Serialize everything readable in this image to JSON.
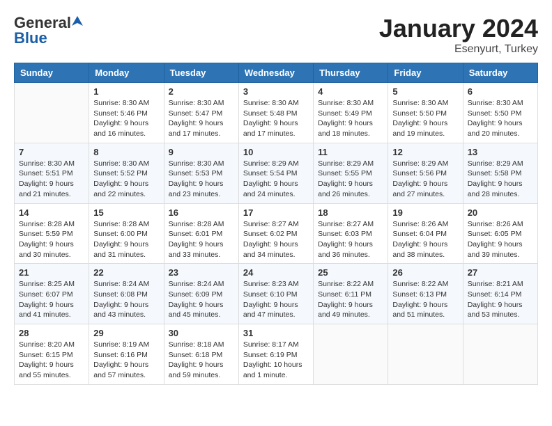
{
  "header": {
    "logo_general": "General",
    "logo_blue": "Blue",
    "month_title": "January 2024",
    "subtitle": "Esenyurt, Turkey"
  },
  "calendar": {
    "days_of_week": [
      "Sunday",
      "Monday",
      "Tuesday",
      "Wednesday",
      "Thursday",
      "Friday",
      "Saturday"
    ],
    "weeks": [
      [
        {
          "day": "",
          "info": ""
        },
        {
          "day": "1",
          "info": "Sunrise: 8:30 AM\nSunset: 5:46 PM\nDaylight: 9 hours\nand 16 minutes."
        },
        {
          "day": "2",
          "info": "Sunrise: 8:30 AM\nSunset: 5:47 PM\nDaylight: 9 hours\nand 17 minutes."
        },
        {
          "day": "3",
          "info": "Sunrise: 8:30 AM\nSunset: 5:48 PM\nDaylight: 9 hours\nand 17 minutes."
        },
        {
          "day": "4",
          "info": "Sunrise: 8:30 AM\nSunset: 5:49 PM\nDaylight: 9 hours\nand 18 minutes."
        },
        {
          "day": "5",
          "info": "Sunrise: 8:30 AM\nSunset: 5:50 PM\nDaylight: 9 hours\nand 19 minutes."
        },
        {
          "day": "6",
          "info": "Sunrise: 8:30 AM\nSunset: 5:50 PM\nDaylight: 9 hours\nand 20 minutes."
        }
      ],
      [
        {
          "day": "7",
          "info": ""
        },
        {
          "day": "8",
          "info": "Sunrise: 8:30 AM\nSunset: 5:52 PM\nDaylight: 9 hours\nand 22 minutes."
        },
        {
          "day": "9",
          "info": "Sunrise: 8:30 AM\nSunset: 5:53 PM\nDaylight: 9 hours\nand 23 minutes."
        },
        {
          "day": "10",
          "info": "Sunrise: 8:29 AM\nSunset: 5:54 PM\nDaylight: 9 hours\nand 24 minutes."
        },
        {
          "day": "11",
          "info": "Sunrise: 8:29 AM\nSunset: 5:55 PM\nDaylight: 9 hours\nand 26 minutes."
        },
        {
          "day": "12",
          "info": "Sunrise: 8:29 AM\nSunset: 5:56 PM\nDaylight: 9 hours\nand 27 minutes."
        },
        {
          "day": "13",
          "info": "Sunrise: 8:29 AM\nSunset: 5:58 PM\nDaylight: 9 hours\nand 28 minutes."
        }
      ],
      [
        {
          "day": "14",
          "info": ""
        },
        {
          "day": "15",
          "info": "Sunrise: 8:28 AM\nSunset: 6:00 PM\nDaylight: 9 hours\nand 31 minutes."
        },
        {
          "day": "16",
          "info": "Sunrise: 8:28 AM\nSunset: 6:01 PM\nDaylight: 9 hours\nand 33 minutes."
        },
        {
          "day": "17",
          "info": "Sunrise: 8:27 AM\nSunset: 6:02 PM\nDaylight: 9 hours\nand 34 minutes."
        },
        {
          "day": "18",
          "info": "Sunrise: 8:27 AM\nSunset: 6:03 PM\nDaylight: 9 hours\nand 36 minutes."
        },
        {
          "day": "19",
          "info": "Sunrise: 8:26 AM\nSunset: 6:04 PM\nDaylight: 9 hours\nand 38 minutes."
        },
        {
          "day": "20",
          "info": "Sunrise: 8:26 AM\nSunset: 6:05 PM\nDaylight: 9 hours\nand 39 minutes."
        }
      ],
      [
        {
          "day": "21",
          "info": ""
        },
        {
          "day": "22",
          "info": "Sunrise: 8:24 AM\nSunset: 6:08 PM\nDaylight: 9 hours\nand 43 minutes."
        },
        {
          "day": "23",
          "info": "Sunrise: 8:24 AM\nSunset: 6:09 PM\nDaylight: 9 hours\nand 45 minutes."
        },
        {
          "day": "24",
          "info": "Sunrise: 8:23 AM\nSunset: 6:10 PM\nDaylight: 9 hours\nand 47 minutes."
        },
        {
          "day": "25",
          "info": "Sunrise: 8:22 AM\nSunset: 6:11 PM\nDaylight: 9 hours\nand 49 minutes."
        },
        {
          "day": "26",
          "info": "Sunrise: 8:22 AM\nSunset: 6:13 PM\nDaylight: 9 hours\nand 51 minutes."
        },
        {
          "day": "27",
          "info": "Sunrise: 8:21 AM\nSunset: 6:14 PM\nDaylight: 9 hours\nand 53 minutes."
        }
      ],
      [
        {
          "day": "28",
          "info": ""
        },
        {
          "day": "29",
          "info": "Sunrise: 8:19 AM\nSunset: 6:16 PM\nDaylight: 9 hours\nand 57 minutes."
        },
        {
          "day": "30",
          "info": "Sunrise: 8:18 AM\nSunset: 6:18 PM\nDaylight: 9 hours\nand 59 minutes."
        },
        {
          "day": "31",
          "info": "Sunrise: 8:17 AM\nSunset: 6:19 PM\nDaylight: 10 hours\nand 1 minute."
        },
        {
          "day": "",
          "info": ""
        },
        {
          "day": "",
          "info": ""
        },
        {
          "day": "",
          "info": ""
        }
      ]
    ],
    "week1_sunday_info": "Sunrise: 8:30 AM\nSunset: 5:51 PM\nDaylight: 9 hours\nand 21 minutes.",
    "week3_sunday_info": "Sunrise: 8:28 AM\nSunset: 5:59 PM\nDaylight: 9 hours\nand 30 minutes.",
    "week4_sunday_info": "Sunrise: 8:25 AM\nSunset: 6:07 PM\nDaylight: 9 hours\nand 41 minutes.",
    "week5_sunday_info": "Sunrise: 8:20 AM\nSunset: 6:15 PM\nDaylight: 9 hours\nand 55 minutes."
  }
}
